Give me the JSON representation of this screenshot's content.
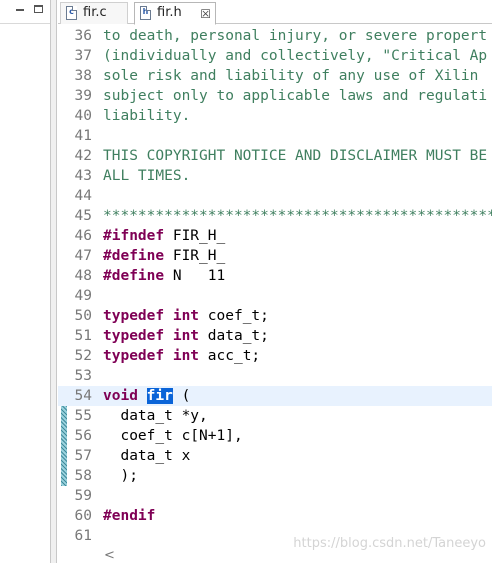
{
  "left_pane": {
    "minimize_icon": "minimize-icon",
    "maximize_icon": "maximize-icon"
  },
  "tabs": [
    {
      "label": "fir.c",
      "icon": "c"
    },
    {
      "label": "fir.h",
      "icon": "h",
      "close": "☒"
    }
  ],
  "colors": {
    "keyword": "#7f0055",
    "comment": "#3f7f5f",
    "line_number": "#787878",
    "selection": "#0a64d8",
    "current_line": "#e8f2fe",
    "change_marker": "#3f8a9b"
  },
  "lines": [
    {
      "n": "36",
      "text": "to death, personal injury, or severe propert"
    },
    {
      "n": "37",
      "text": "(individually and collectively, \"Critical Ap"
    },
    {
      "n": "38",
      "text": "sole risk and liability of any use of Xilin"
    },
    {
      "n": "39",
      "text": "subject only to applicable laws and regulati"
    },
    {
      "n": "40",
      "text": "liability."
    },
    {
      "n": "41",
      "text": ""
    },
    {
      "n": "42",
      "text": "THIS COPYRIGHT NOTICE AND DISCLAIMER MUST BE"
    },
    {
      "n": "43",
      "text": "ALL TIMES."
    },
    {
      "n": "44",
      "text": ""
    },
    {
      "n": "45",
      "text": "*********************************************"
    },
    {
      "n": "46",
      "kw": "#ifndef",
      "rest": " FIR_H_"
    },
    {
      "n": "47",
      "kw": "#define",
      "rest": " FIR_H_"
    },
    {
      "n": "48",
      "kw": "#define",
      "rest": " N   11"
    },
    {
      "n": "49",
      "text": ""
    },
    {
      "n": "50",
      "kw": "typedef",
      "kw2": "int",
      "rest": " coef_t;"
    },
    {
      "n": "51",
      "kw": "typedef",
      "kw2": "int",
      "rest": " data_t;"
    },
    {
      "n": "52",
      "kw": "typedef",
      "kw2": "int",
      "rest": " acc_t;"
    },
    {
      "n": "53",
      "text": ""
    },
    {
      "n": "54",
      "kw": "void",
      "sel": "fir",
      "rest": " ("
    },
    {
      "n": "55",
      "code": "  data_t *y,"
    },
    {
      "n": "56",
      "code": "  coef_t c[N+1],"
    },
    {
      "n": "57",
      "code": "  data_t x"
    },
    {
      "n": "58",
      "code": "  );"
    },
    {
      "n": "59",
      "text": ""
    },
    {
      "n": "60",
      "kw": "#endif",
      "rest": ""
    },
    {
      "n": "61",
      "text": ""
    }
  ],
  "scroll_left": "<",
  "watermark": "https://blog.csdn.net/Taneeyo"
}
